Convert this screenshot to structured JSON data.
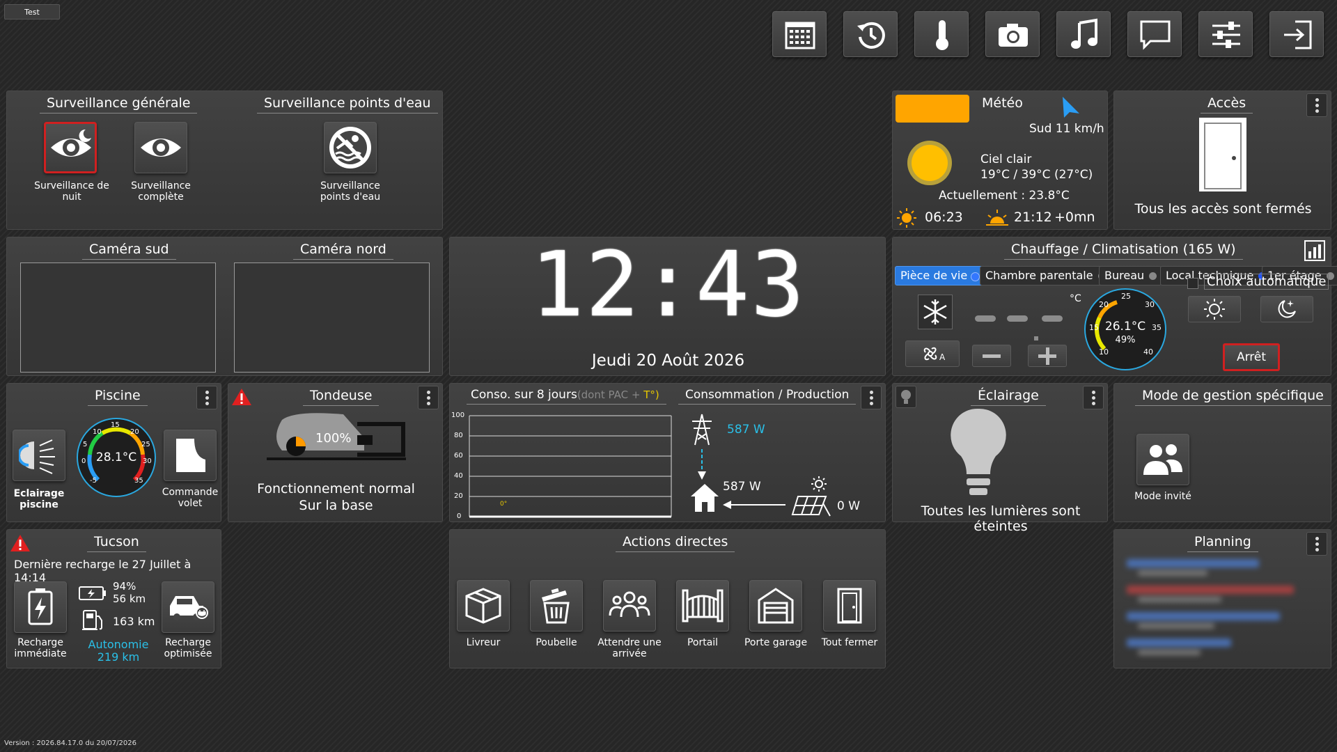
{
  "window": {
    "test_label": "Test",
    "version": "Version : 2026.84.17.0 du 20/07/2026"
  },
  "toolbar": {
    "icons": [
      "calendar-icon",
      "history-icon",
      "thermometer-icon",
      "camera-icon",
      "music-icon",
      "chat-icon",
      "sliders-icon",
      "logout-icon"
    ]
  },
  "surveillance": {
    "title_general": "Surveillance générale",
    "title_water": "Surveillance points d'eau",
    "night_label_1": "Surveillance de",
    "night_label_2": "nuit",
    "full_label_1": "Surveillance",
    "full_label_2": "complète",
    "water_label_1": "Surveillance",
    "water_label_2": "points d'eau",
    "active_color": "#d02020"
  },
  "meteo": {
    "title": "Météo",
    "wind": "Sud 11 km/h",
    "condition": "Ciel clair",
    "temps": "19°C / 39°C  (27°C)",
    "current": "Actuellement : 23.8°C",
    "sunrise": "06:23",
    "sunset": "21:12",
    "offset": "+0mn",
    "accent_color": "#ffa500"
  },
  "acces": {
    "title": "Accès",
    "status": "Tous les accès sont fermés"
  },
  "cameras": {
    "south": "Caméra sud",
    "north": "Caméra nord"
  },
  "clock": {
    "time": "12:43",
    "date": "Jeudi 20 Août 2026"
  },
  "chauffage": {
    "title": "Chauffage / Climatisation (165 W)",
    "rooms": [
      {
        "label": "Pièce de vie",
        "dot_color": "#3377ff"
      },
      {
        "label": "Chambre parentale",
        "dot_color": "#999999"
      },
      {
        "label": "Bureau",
        "dot_color": "#999999"
      },
      {
        "label": "Local technique",
        "dot_color": "#2255ff"
      },
      {
        "label": "1er étage",
        "dot_color": "#999999"
      }
    ],
    "unit": "°C",
    "fan_mode": "A",
    "auto_choice": "Choix automatique",
    "stop_label": "Arrêt",
    "gauge": {
      "temp": "26.1°C",
      "humidity": "49%",
      "ticks": [
        "10",
        "15",
        "20",
        "25",
        "30",
        "35",
        "40"
      ]
    }
  },
  "piscine": {
    "title": "Piscine",
    "light_label_1": "Eclairage",
    "light_label_2": "piscine",
    "shutter_label_1": "Commande",
    "shutter_label_2": "volet",
    "gauge": {
      "temp": "28.1°C",
      "ticks": [
        "-5",
        "0",
        "5",
        "10",
        "15",
        "20",
        "25",
        "30",
        "35"
      ]
    }
  },
  "tondeuse": {
    "title": "Tondeuse",
    "battery": "100%",
    "status_1": "Fonctionnement normal",
    "status_2": "Sur la base"
  },
  "conso": {
    "title": "Conso. sur 8 jours",
    "title_note_1": "(dont PAC + ",
    "title_note_2": "T°)",
    "y_ticks": [
      "100",
      "80",
      "60",
      "40",
      "20",
      "0"
    ],
    "marker": "0°"
  },
  "production": {
    "title": "Consommation / Production",
    "grid": "587 W",
    "house": "587 W",
    "solar": "0 W"
  },
  "eclairage": {
    "title": "Éclairage",
    "status": "Toutes les lumières sont éteintes"
  },
  "mode": {
    "title": "Mode de gestion spécifique",
    "guest_label": "Mode invité"
  },
  "tucson": {
    "title": "Tucson",
    "last_charge": "Dernière recharge le 27 Juillet à 14:14",
    "battery_pct": "94%",
    "battery_km": "56 km",
    "fuel_km": "163 km",
    "autonomy_1": "Autonomie",
    "autonomy_2": "219 km",
    "charge_now_1": "Recharge",
    "charge_now_2": "immédiate",
    "charge_opt_1": "Recharge",
    "charge_opt_2": "optimisée"
  },
  "actions": {
    "title": "Actions directes",
    "items": [
      {
        "l1": "Livreur",
        "l2": ""
      },
      {
        "l1": "Poubelle",
        "l2": ""
      },
      {
        "l1": "Attendre une",
        "l2": "arrivée"
      },
      {
        "l1": "Portail",
        "l2": ""
      },
      {
        "l1": "Porte garage",
        "l2": ""
      },
      {
        "l1": "Tout fermer",
        "l2": ""
      }
    ]
  },
  "planning": {
    "title": "Planning"
  }
}
